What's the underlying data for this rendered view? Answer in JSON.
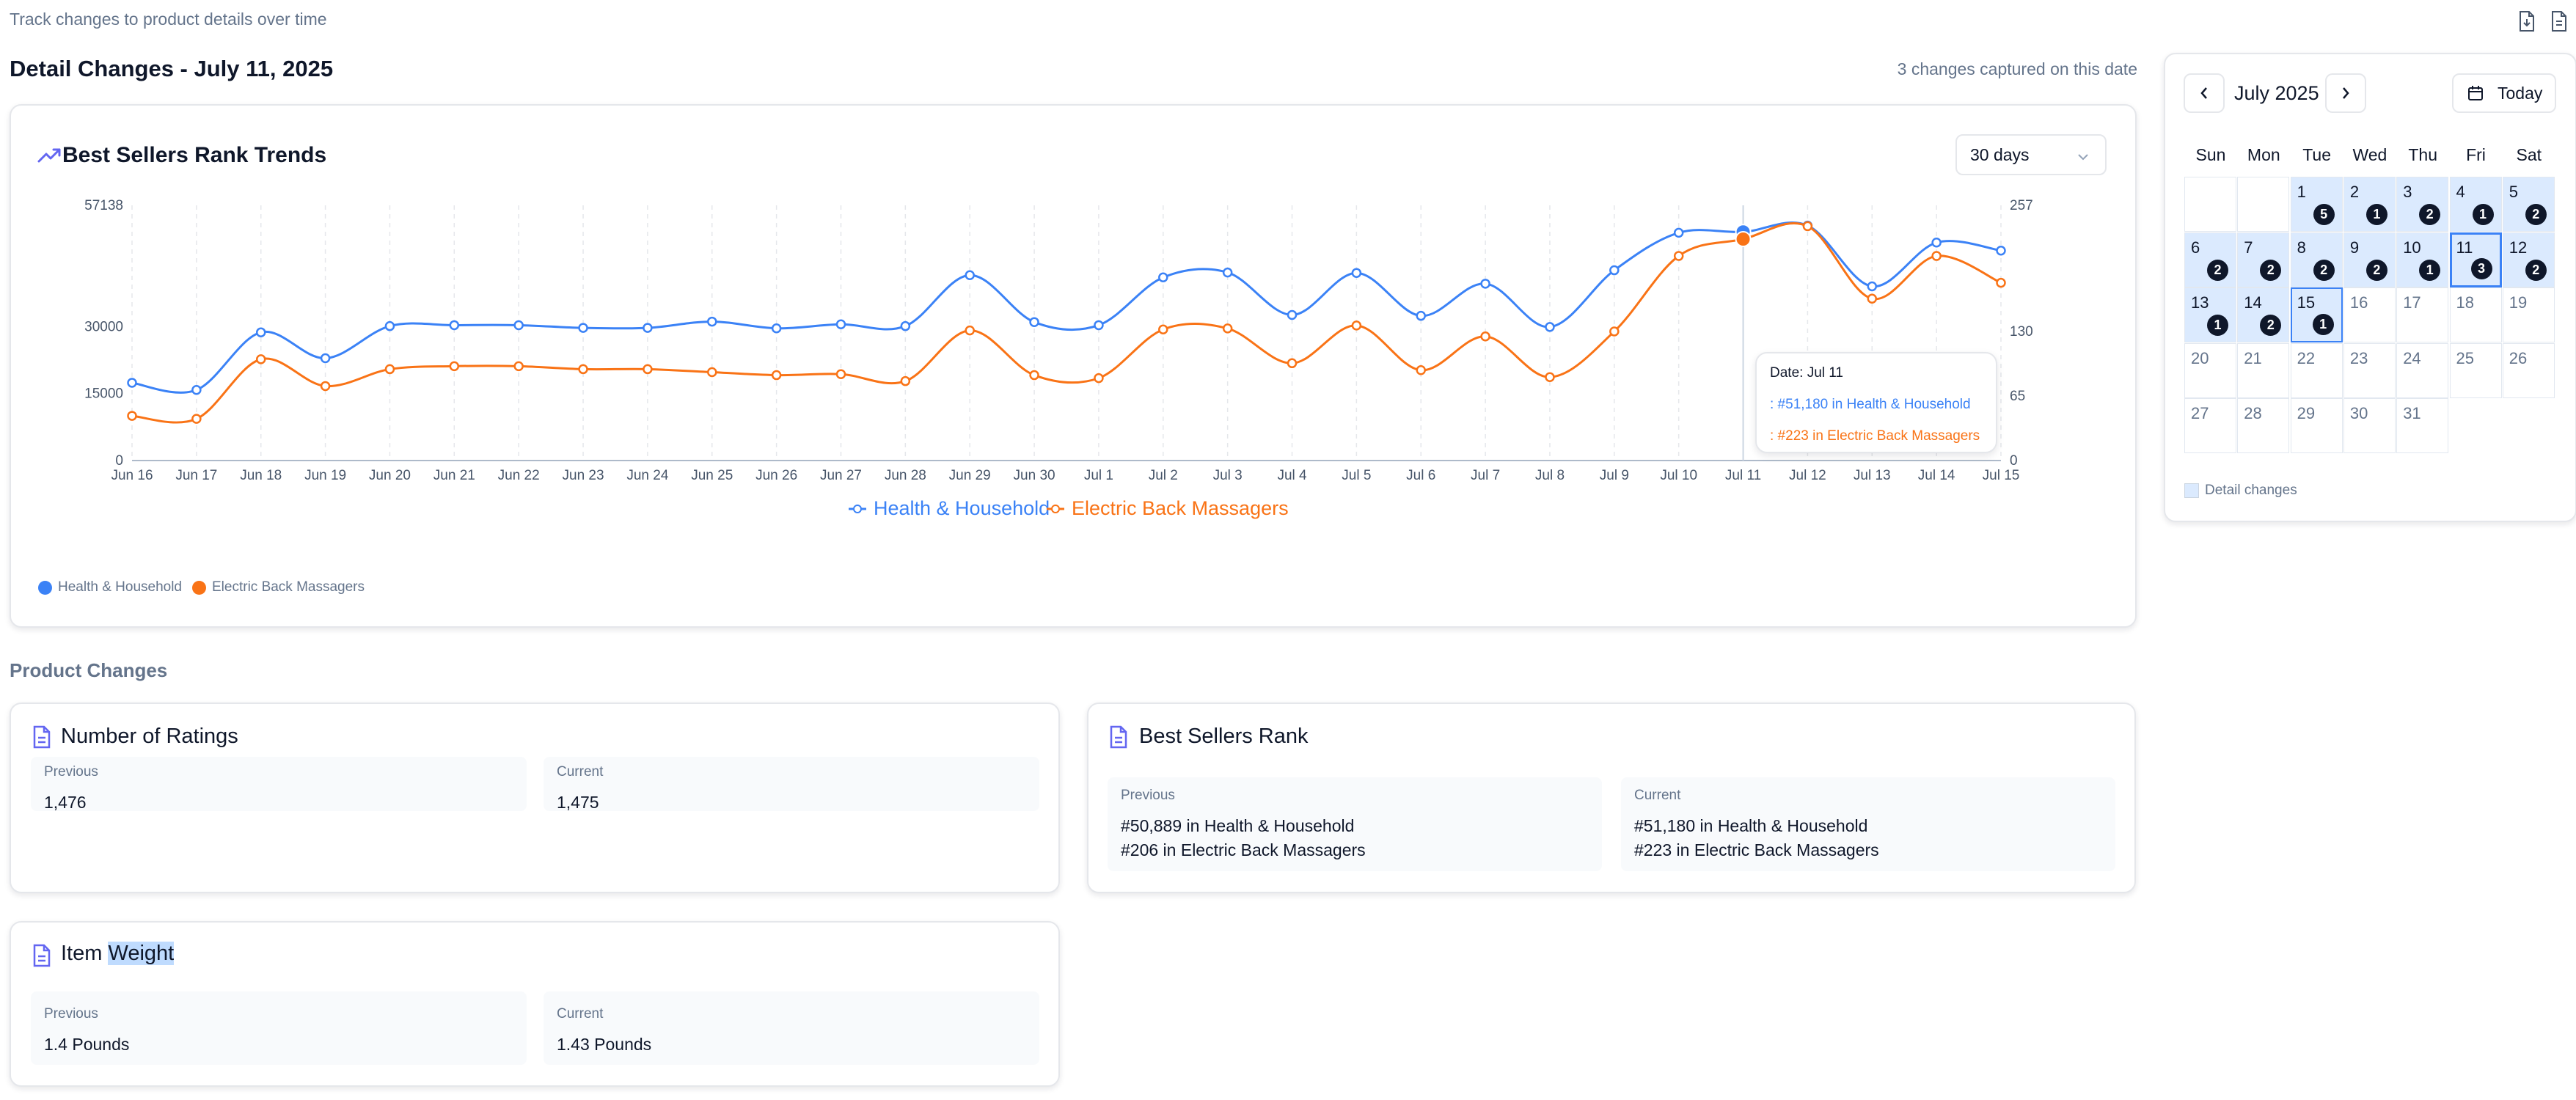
{
  "header": {
    "subtitle": "Track changes to product details over time",
    "title": "Detail Changes - July 11, 2025",
    "changes_count": "3 changes captured on this date",
    "icons": [
      "file-export-icon",
      "file-download-icon"
    ]
  },
  "chart_card": {
    "title": "Best Sellers Rank Trends",
    "title_icon": "trending-up-icon",
    "range_select": "30 days",
    "tooltip": {
      "date": "Date: Jul 11",
      "line1": ": #51,180 in Health & Household",
      "line2": ": #223 in Electric Back Massagers"
    },
    "bottom_legend": [
      "Health & Household",
      "Electric Back Massagers"
    ]
  },
  "chart_data": {
    "type": "line",
    "categories": [
      "Jun 16",
      "Jun 17",
      "Jun 18",
      "Jun 19",
      "Jun 20",
      "Jun 21",
      "Jun 22",
      "Jun 23",
      "Jun 24",
      "Jun 25",
      "Jun 26",
      "Jun 27",
      "Jun 28",
      "Jun 29",
      "Jun 30",
      "Jul 1",
      "Jul 2",
      "Jul 3",
      "Jul 4",
      "Jul 5",
      "Jul 6",
      "Jul 7",
      "Jul 8",
      "Jul 9",
      "Jul 10",
      "Jul 11",
      "Jul 12",
      "Jul 13",
      "Jul 14",
      "Jul 15"
    ],
    "left_axis": {
      "ticks": [
        0,
        15000,
        30000,
        57138
      ],
      "ylim": [
        0,
        57138
      ]
    },
    "right_axis": {
      "ticks": [
        0,
        65,
        130,
        257
      ],
      "ylim": [
        0,
        257
      ]
    },
    "series": [
      {
        "name": "Health & Household",
        "axis": "left",
        "color": "#3b82f6",
        "values": [
          17400,
          15800,
          28700,
          22900,
          30100,
          30300,
          30300,
          29700,
          29700,
          31100,
          29600,
          30500,
          30100,
          41500,
          31000,
          30300,
          41000,
          42100,
          32600,
          42000,
          32400,
          39600,
          29900,
          42600,
          51000,
          51180,
          52600,
          39000,
          48800,
          47000
        ]
      },
      {
        "name": "Electric Back Massagers",
        "axis": "right",
        "color": "#f97316",
        "values": [
          45,
          42,
          102,
          75,
          92,
          95,
          95,
          92,
          92,
          89,
          86,
          87,
          80,
          131,
          86,
          83,
          132,
          133,
          98,
          136,
          91,
          125,
          84,
          130,
          206,
          223,
          236,
          163,
          206,
          179
        ]
      }
    ],
    "highlight_index": 25,
    "grid": true,
    "legend": "bottom-center"
  },
  "product_changes": {
    "section_title": "Product Changes",
    "cards": [
      {
        "title": "Number of Ratings",
        "previous_label": "Previous",
        "previous": "1,476",
        "current_label": "Current",
        "current": "1,475"
      },
      {
        "title": "Best Sellers Rank",
        "previous_label": "Previous",
        "previous_lines": [
          "#50,889 in Health & Household",
          "#206 in Electric Back Massagers"
        ],
        "current_label": "Current",
        "current_lines": [
          "#51,180 in Health & Household",
          "#223 in Electric Back Massagers"
        ]
      },
      {
        "title_prefix": "Item ",
        "title_highlight": "Weight",
        "previous_label": "Previous",
        "previous": "1.4 Pounds",
        "current_label": "Current",
        "current": "1.43 Pounds"
      }
    ]
  },
  "calendar": {
    "month": "July 2025",
    "today_label": "Today",
    "weekdays": [
      "Sun",
      "Mon",
      "Tue",
      "Wed",
      "Thu",
      "Fri",
      "Sat"
    ],
    "first_weekday": 2,
    "days_in_month": 31,
    "counts": {
      "1": 5,
      "2": 1,
      "3": 2,
      "4": 1,
      "5": 2,
      "6": 2,
      "7": 2,
      "8": 2,
      "9": 2,
      "10": 1,
      "11": 3,
      "12": 2,
      "13": 1,
      "14": 2,
      "15": 1
    },
    "selected_day": 11,
    "today_day": 15,
    "legend": "Detail changes"
  },
  "colors": {
    "blue": "#3b82f6",
    "orange": "#f97316",
    "accent_icon": "#6366f1"
  }
}
